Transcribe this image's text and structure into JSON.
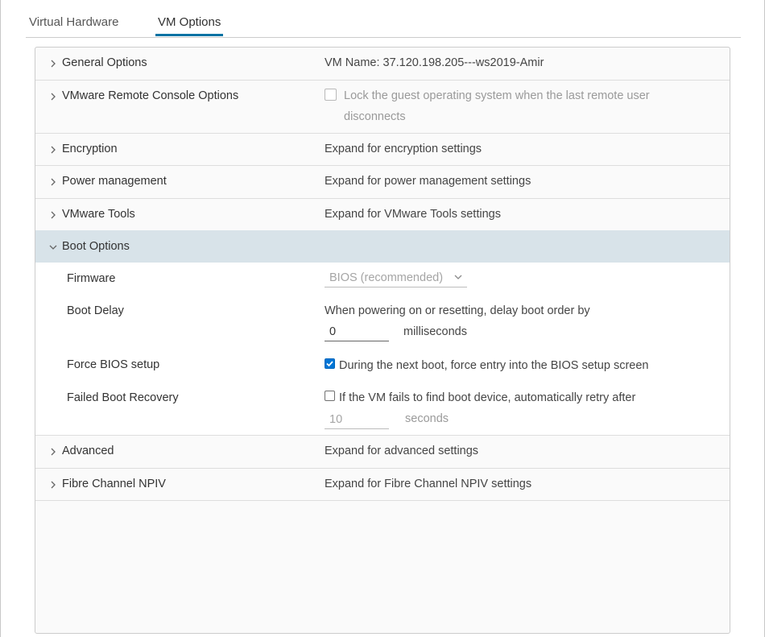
{
  "tabs": [
    {
      "label": "Virtual Hardware",
      "active": false
    },
    {
      "label": "VM Options",
      "active": true
    }
  ],
  "accent_color": "#0072a3",
  "sections": {
    "general": {
      "label": "General Options",
      "value": "VM Name: 37.120.198.205---ws2019-Amir"
    },
    "remote_console": {
      "label": "VMware Remote Console Options",
      "checkbox_label_line1": "Lock the guest operating system when the last remote user",
      "checkbox_label_line2": "disconnects",
      "checked": false
    },
    "encryption": {
      "label": "Encryption",
      "value": "Expand for encryption settings"
    },
    "power": {
      "label": "Power management",
      "value": "Expand for power management settings"
    },
    "tools": {
      "label": "VMware Tools",
      "value": "Expand for VMware Tools settings"
    },
    "boot": {
      "label": "Boot Options",
      "firmware": {
        "label": "Firmware",
        "selected": "BIOS (recommended)"
      },
      "boot_delay": {
        "label": "Boot Delay",
        "text": "When powering on or resetting, delay boot order by",
        "value": "0",
        "unit": "milliseconds"
      },
      "force_bios": {
        "label": "Force BIOS setup",
        "text": "During the next boot, force entry into the BIOS setup screen",
        "checked": true
      },
      "failed_recovery": {
        "label": "Failed Boot Recovery",
        "text": "If the VM fails to find boot device, automatically retry after",
        "checked": false,
        "value": "10",
        "unit": "seconds"
      }
    },
    "advanced": {
      "label": "Advanced",
      "value": "Expand for advanced settings"
    },
    "npiv": {
      "label": "Fibre Channel NPIV",
      "value": "Expand for Fibre Channel NPIV settings"
    }
  }
}
